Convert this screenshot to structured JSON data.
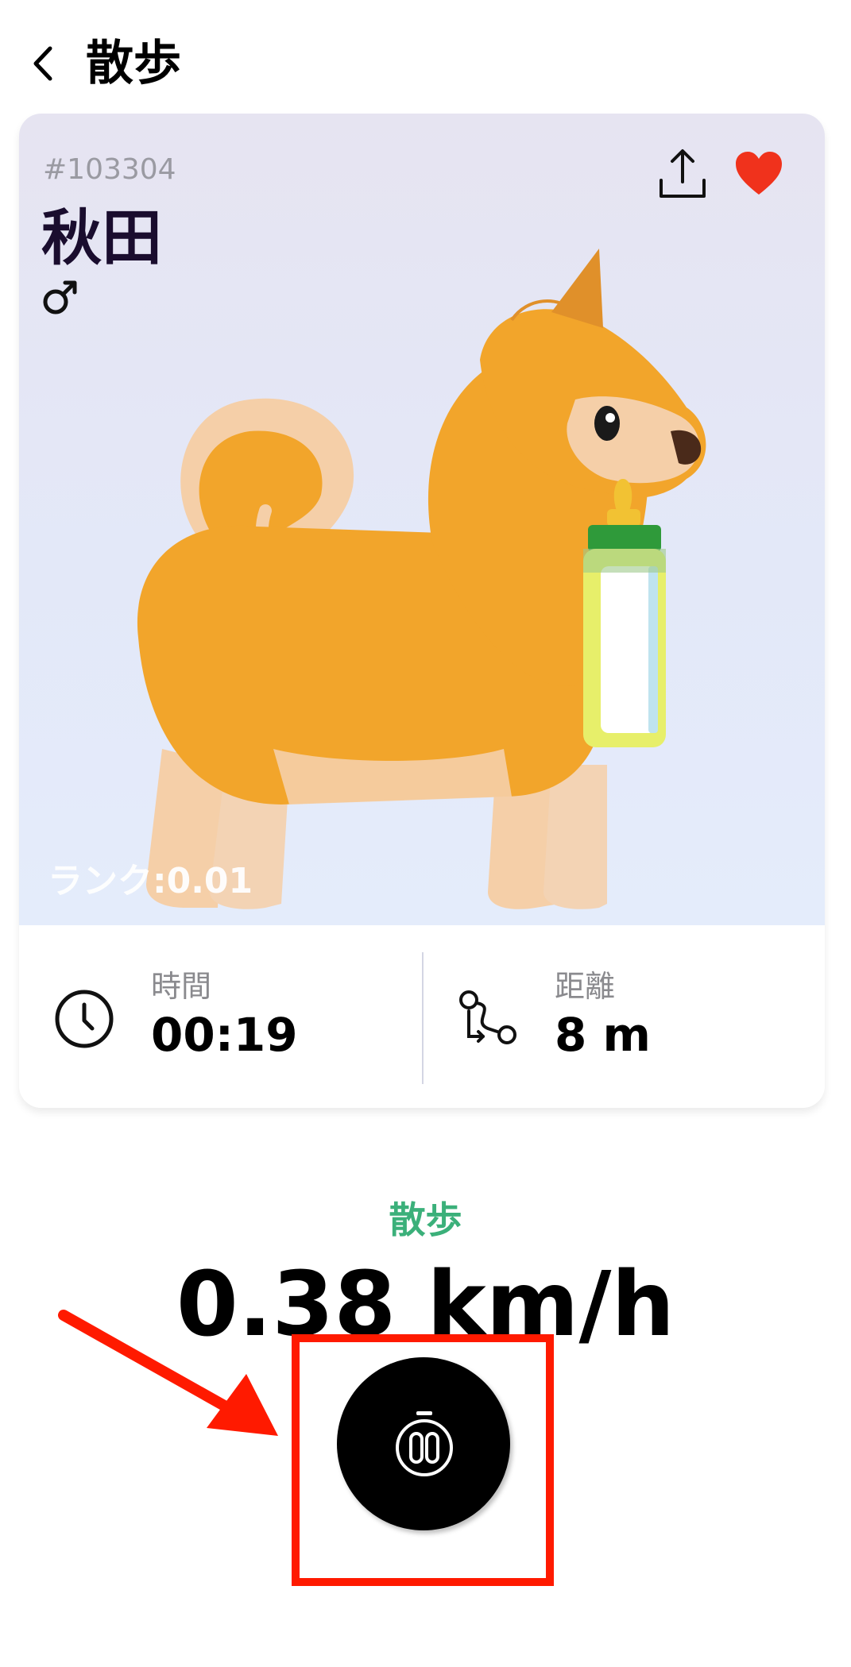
{
  "header": {
    "title": "散歩"
  },
  "pet": {
    "id": "#103304",
    "name": "秋田",
    "gender": "♂",
    "rank": "ランク:0.01"
  },
  "stats": {
    "time": {
      "label": "時間",
      "value": "00:19"
    },
    "distance": {
      "label": "距離",
      "value": "8 m"
    }
  },
  "activity": {
    "mode": "散歩",
    "speed": "0.38 km/h"
  },
  "colors": {
    "accent_green": "#3bb07a",
    "heart_red": "#f0321c",
    "highlight_red": "#ff1a00",
    "dog_orange": "#f2a52b"
  },
  "icons": {
    "back": "chevron-left-icon",
    "share": "share-icon",
    "favorite": "heart-icon",
    "time": "clock-icon",
    "distance": "route-icon",
    "pause": "stopwatch-pause-icon"
  }
}
